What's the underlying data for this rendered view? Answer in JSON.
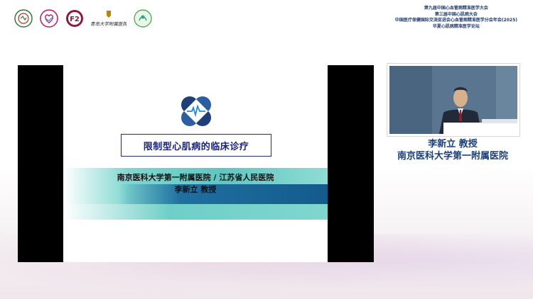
{
  "header": {
    "logos": [
      {
        "name": "society-logo-1-icon"
      },
      {
        "name": "heart-society-logo-icon"
      },
      {
        "name": "f2-logo-icon"
      },
      {
        "name": "university-crest-icon",
        "caption": "青岛大学附属医院"
      },
      {
        "name": "green-society-logo-icon"
      }
    ],
    "title_lines": [
      "第九届中国心血管病精准医学大会",
      "第三届中国心肌病大会",
      "中国医疗保健国际交流促进会心血管病精准医学分会年会(2025)",
      "华夏心肌病精准医学论坛"
    ]
  },
  "slide": {
    "title": "限制型心肌病的临床诊疗",
    "affiliation": "南京医科大学第一附属医院 / 江苏省人民医院",
    "presenter": "李新立 教授",
    "colors": {
      "navy": "#1a237e",
      "teal": "#5ec6c2",
      "blue": "#135b8c"
    }
  },
  "speaker": {
    "name_title": "李新立 教授",
    "hospital": "南京医科大学第一附属医院"
  }
}
